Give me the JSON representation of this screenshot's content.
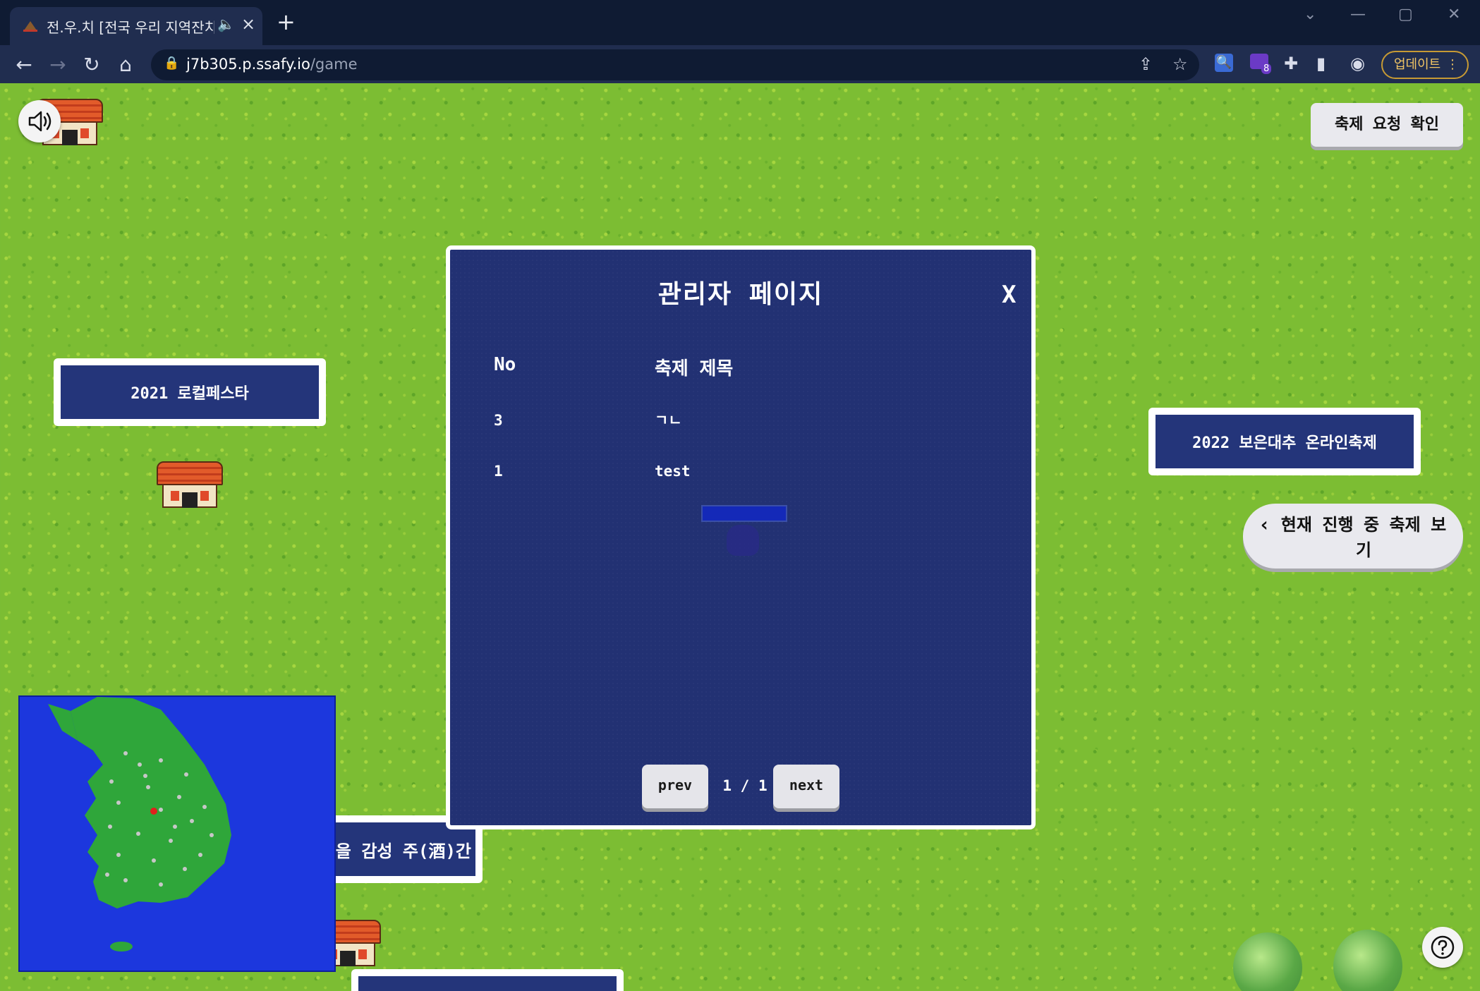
{
  "browser": {
    "tab_title": "전.우.치 [전국 우리 지역잔치",
    "url_host": "j7b305.p.ssafy.io",
    "url_path": "/game",
    "update_label": "업데이트",
    "extension_badge": "8"
  },
  "game": {
    "festival_request_button": "축제 요청 확인",
    "current_festivals_button": "현재 진행 중 축제 보기",
    "signs": {
      "local_festa": "2021 로컬페스타",
      "boeun_jujube": "2022 보은대추 온라인축제",
      "partial_sign": "을 감성 주(酒)간"
    }
  },
  "modal": {
    "title": "관리자 페이지",
    "close_label": "X",
    "columns": {
      "no": "No",
      "title": "축제 제목"
    },
    "rows": [
      {
        "no": "3",
        "title": "ㄱㄴ"
      },
      {
        "no": "1",
        "title": "test"
      }
    ],
    "prev_label": "prev",
    "page_indicator": "1 / 1",
    "next_label": "next"
  },
  "colors": {
    "grass": "#7cbd33",
    "modal_bg": "#223173",
    "sign_bg": "#24357a",
    "minimap_sea": "#1c37dd",
    "minimap_land": "#2fa63a",
    "player_marker": "#e0201c"
  },
  "icons": {
    "sound": "speaker-icon",
    "help": "question-icon",
    "close": "close-icon"
  }
}
